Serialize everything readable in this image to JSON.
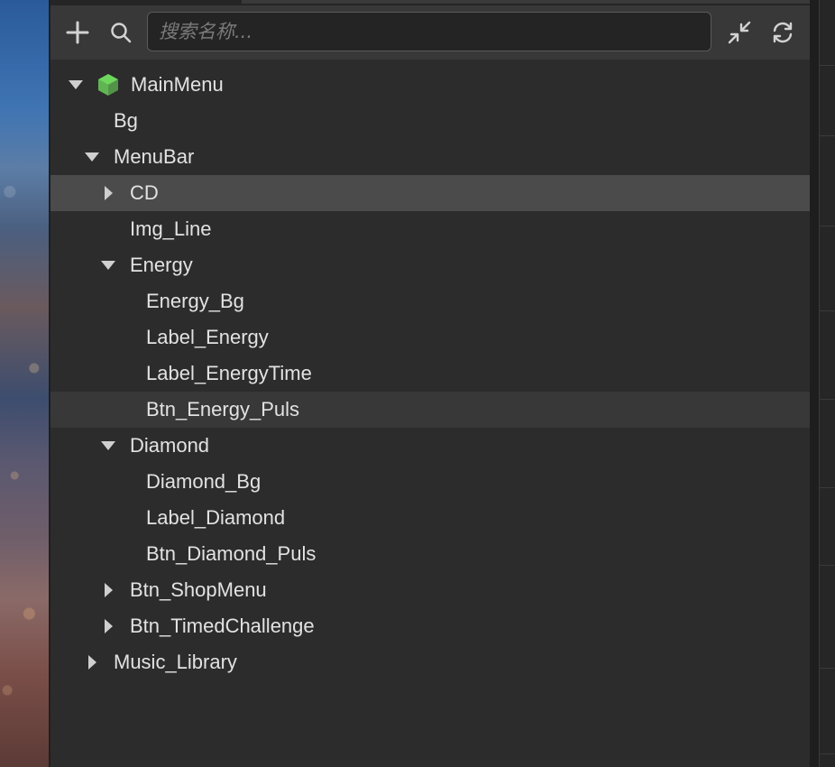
{
  "toolbar": {
    "add_icon": "plus-icon",
    "search_icon": "search-icon",
    "search_placeholder": "搜索名称...",
    "search_value": "",
    "collapse_icon": "collapse-icon",
    "refresh_icon": "refresh-icon"
  },
  "tree": [
    {
      "label": "MainMenu",
      "depth": 0,
      "expanded": true,
      "has_children": true,
      "icon": "cube-icon",
      "icon_color": "#6ed85c"
    },
    {
      "label": "Bg",
      "depth": 1,
      "has_children": false
    },
    {
      "label": "MenuBar",
      "depth": 1,
      "expanded": true,
      "has_children": true
    },
    {
      "label": "CD",
      "depth": 2,
      "expanded": false,
      "has_children": true,
      "selected": true
    },
    {
      "label": "Img_Line",
      "depth": 2,
      "has_children": false
    },
    {
      "label": "Energy",
      "depth": 2,
      "expanded": true,
      "has_children": true
    },
    {
      "label": "Energy_Bg",
      "depth": 3,
      "has_children": false
    },
    {
      "label": "Label_Energy",
      "depth": 3,
      "has_children": false
    },
    {
      "label": "Label_EnergyTime",
      "depth": 3,
      "has_children": false
    },
    {
      "label": "Btn_Energy_Puls",
      "depth": 3,
      "has_children": false,
      "hovered": true
    },
    {
      "label": "Diamond",
      "depth": 2,
      "expanded": true,
      "has_children": true
    },
    {
      "label": "Diamond_Bg",
      "depth": 3,
      "has_children": false
    },
    {
      "label": "Label_Diamond",
      "depth": 3,
      "has_children": false
    },
    {
      "label": "Btn_Diamond_Puls",
      "depth": 3,
      "has_children": false
    },
    {
      "label": "Btn_ShopMenu",
      "depth": 2,
      "expanded": false,
      "has_children": true
    },
    {
      "label": "Btn_TimedChallenge",
      "depth": 2,
      "expanded": false,
      "has_children": true
    },
    {
      "label": "Music_Library",
      "depth": 1,
      "expanded": false,
      "has_children": true
    }
  ],
  "colors": {
    "panel_bg": "#2c2c2c",
    "toolbar_bg": "#383838",
    "selected_row": "#4b4b4b",
    "hover_row": "#383838",
    "text": "#e2e2e2"
  }
}
